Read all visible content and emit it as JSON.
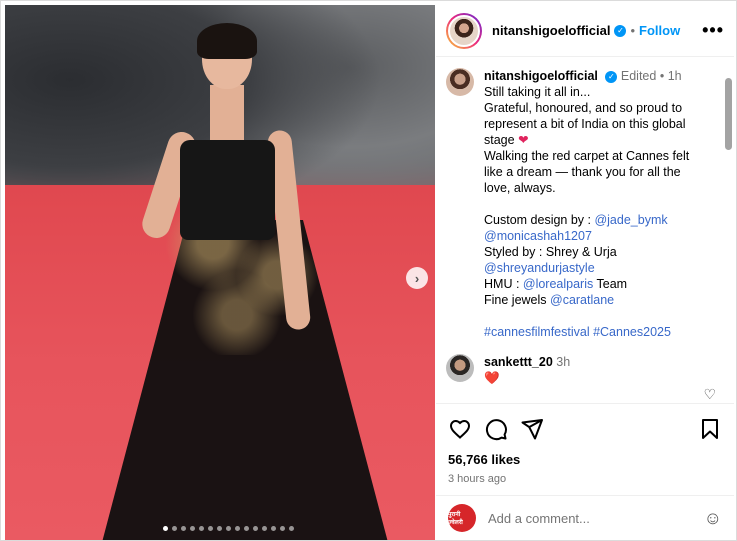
{
  "post": {
    "author": "nitanshigoelofficial",
    "follow_label": "Follow",
    "more_label": "•••",
    "separator": "•",
    "carousel_dots": 15,
    "carousel_active": 0
  },
  "caption": {
    "username": "nitanshigoelofficial",
    "edited": "Edited",
    "time": "1h",
    "line1": "Still taking it all in...",
    "line2": "Grateful, honoured, and so proud to represent a bit of India on this global stage",
    "line3": "Walking the red carpet at Cannes felt like a dream — thank you for all the love, always.",
    "custom_design_label": "Custom design by : ",
    "custom_design_tag1": "@jade_bymk",
    "custom_design_tag2": "@monicashah1207",
    "styled_by": "Styled by : Shrey & Urja",
    "styled_tag": "@shreyandurjastyle",
    "hmu_label": "HMU : ",
    "hmu_tag": "@lorealparis",
    "hmu_suffix": " Team",
    "jewels_label": "Fine jewels ",
    "jewels_tag": "@caratlane",
    "hashtags": "#cannesfilmfestival #Cannes2025"
  },
  "comment": {
    "username": "sankettt_20",
    "time": "3h",
    "text": "❤️"
  },
  "actions": {
    "likes": "56,766 likes",
    "time_ago": "3 hours ago"
  },
  "add_comment": {
    "placeholder": "Add a comment...",
    "avatar_text": "पुरानी ज्वेलरी"
  },
  "colors": {
    "accent": "#0095f6",
    "heart": "#e0245e",
    "link": "#3868c9"
  }
}
